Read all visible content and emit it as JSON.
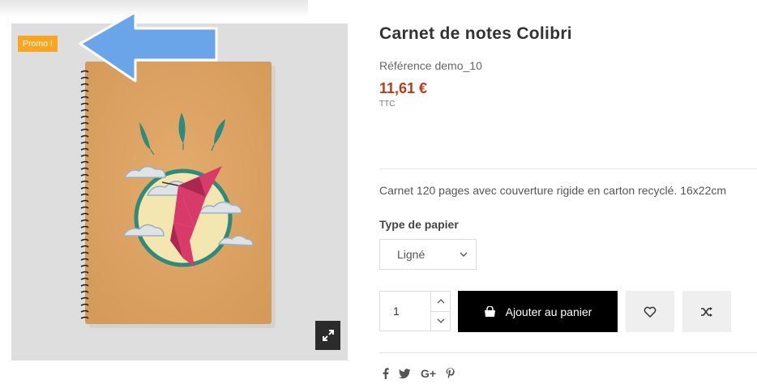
{
  "product": {
    "promo_badge": "Promo !",
    "title": "Carnet de notes Colibri",
    "reference": "Référence demo_10",
    "price": "11,61 €",
    "tax_label": "TTC",
    "description": "Carnet 120 pages avec couverture rigide en carton recyclé. 16x22cm"
  },
  "variant": {
    "label": "Type de papier",
    "selected": "Ligné"
  },
  "cart": {
    "quantity": "1",
    "add_label": "Ajouter au panier"
  },
  "share_icons": [
    "facebook-icon",
    "twitter-icon",
    "google-plus-icon",
    "pinterest-icon"
  ],
  "colors": {
    "price": "#c03a16",
    "promo_badge": "#f6a623",
    "add_to_cart_bg": "#000000",
    "annotation_arrow": "#6aa5ea"
  }
}
